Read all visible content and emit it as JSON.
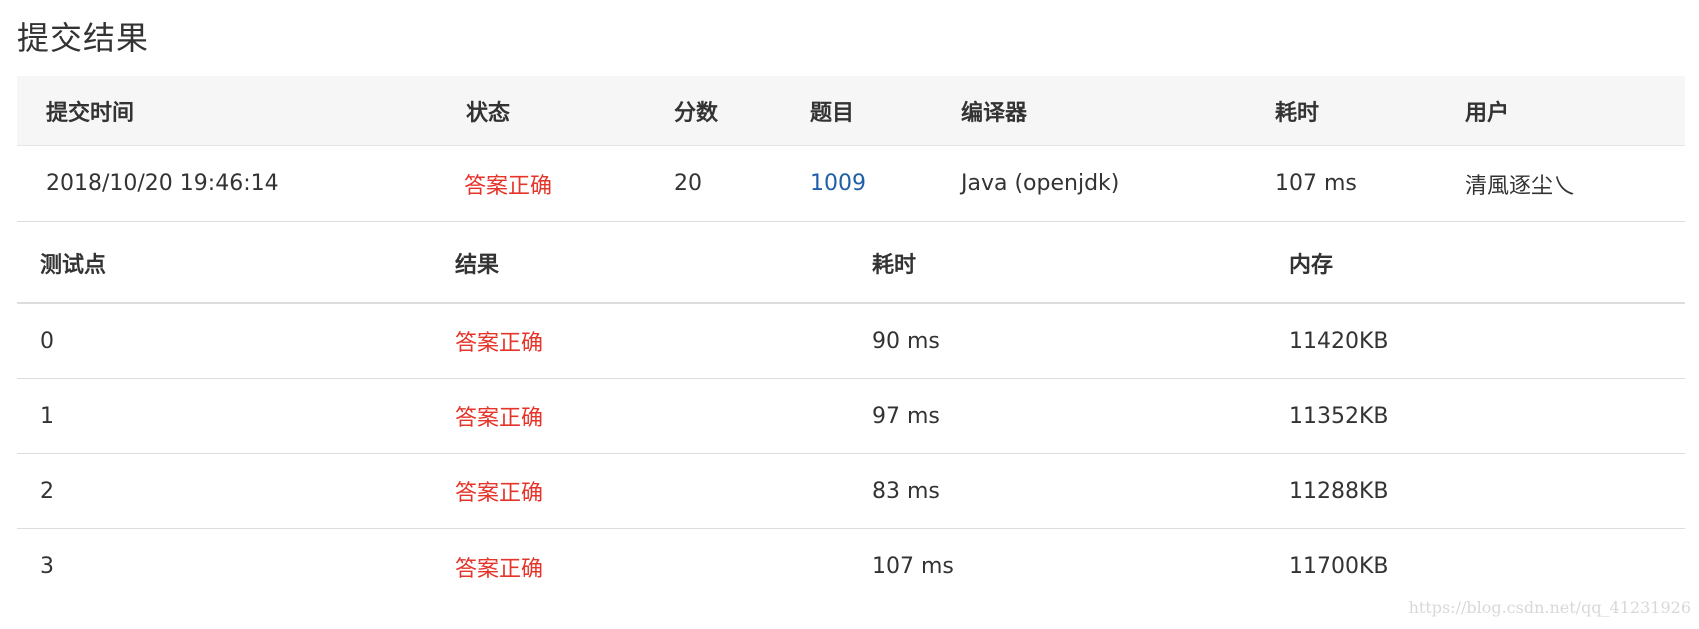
{
  "page_title": "提交结果",
  "submission": {
    "headers": [
      "提交时间",
      "状态",
      "分数",
      "题目",
      "编译器",
      "耗时",
      "用户"
    ],
    "row": {
      "time": "2018/10/20 19:46:14",
      "status": "答案正确",
      "score": "20",
      "problem": "1009",
      "compiler": "Java (openjdk)",
      "elapsed": "107 ms",
      "user": "清風逐尘乀"
    }
  },
  "cases": {
    "headers": [
      "测试点",
      "结果",
      "耗时",
      "内存"
    ],
    "rows": [
      {
        "id": "0",
        "result": "答案正确",
        "time": "90 ms",
        "memory": "11420KB"
      },
      {
        "id": "1",
        "result": "答案正确",
        "time": "97 ms",
        "memory": "11352KB"
      },
      {
        "id": "2",
        "result": "答案正确",
        "time": "83 ms",
        "memory": "11288KB"
      },
      {
        "id": "3",
        "result": "答案正确",
        "time": "107 ms",
        "memory": "11700KB"
      }
    ]
  },
  "watermark": "https://blog.csdn.net/qq_41231926",
  "colors": {
    "status_ok": "#e5342a",
    "link": "#1f5ea8",
    "header_bg": "#f6f6f6"
  }
}
